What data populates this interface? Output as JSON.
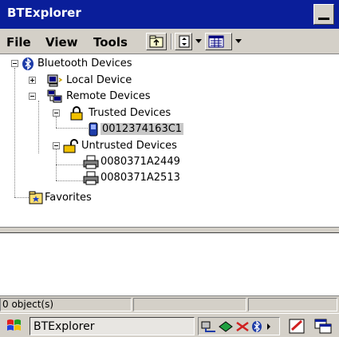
{
  "window": {
    "title": "BTExplorer"
  },
  "menu": {
    "file": "File",
    "view": "View",
    "tools": "Tools"
  },
  "tree": {
    "root": "Bluetooth Devices",
    "local": "Local Device",
    "remote": "Remote Devices",
    "trusted": "Trusted Devices",
    "trusted_device": "0012374163C1",
    "untrusted": "Untrusted Devices",
    "untrusted_devices": [
      "0080371A2449",
      "0080371A2513"
    ],
    "favorites": "Favorites"
  },
  "status": {
    "objects": "0 object(s)"
  },
  "taskbar": {
    "app_label": "BTExplorer"
  },
  "colors": {
    "titlebar": "#0a1e9a",
    "chrome": "#d4d0c8",
    "selection": "#c8c8c8"
  },
  "icons": [
    "minimize-icon",
    "folder-up-icon",
    "sort-icon",
    "view-mode-icon",
    "bluetooth-icon",
    "computer-icon",
    "network-icon",
    "lock-closed-icon",
    "lock-open-icon",
    "phone-icon",
    "printer-icon",
    "favorites-folder-icon",
    "start-icon",
    "network-tray-icon",
    "bluetooth-tray-icon",
    "edit-tray-icon",
    "switch-window-icon"
  ]
}
